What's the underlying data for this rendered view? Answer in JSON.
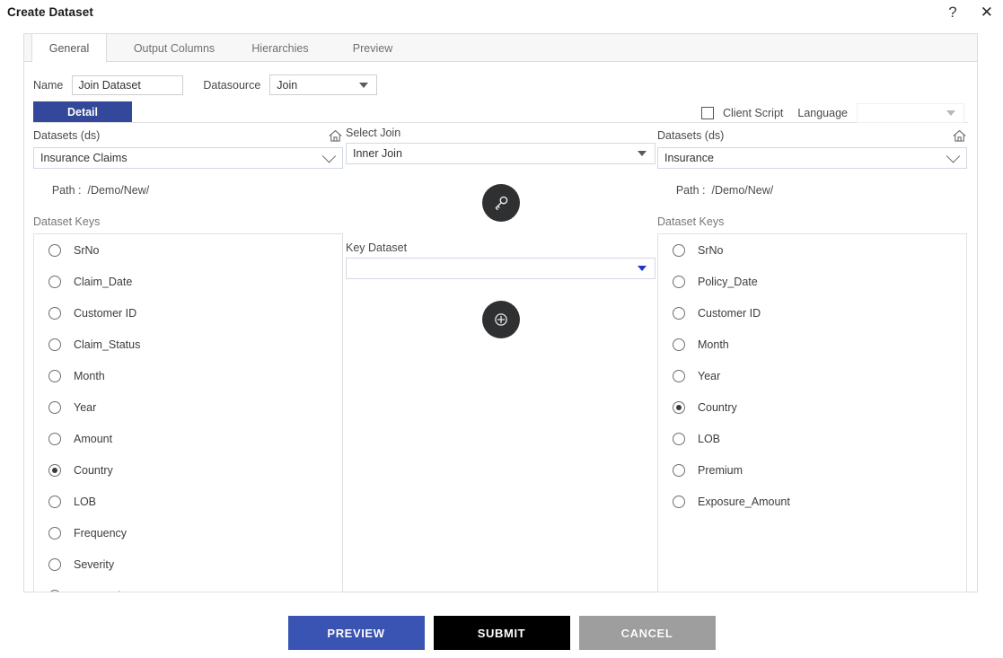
{
  "window": {
    "title": "Create Dataset",
    "help_icon": "question-mark-icon",
    "close_icon": "close-icon"
  },
  "tabs": [
    {
      "label": "General",
      "active": true
    },
    {
      "label": "Output Columns",
      "active": false
    },
    {
      "label": "Hierarchies",
      "active": false
    },
    {
      "label": "Preview",
      "active": false
    }
  ],
  "form": {
    "name_label": "Name",
    "name_value": "Join Dataset",
    "name_placeholder": "",
    "datasource_label": "Datasource",
    "datasource_value": "Join"
  },
  "detail_tab": {
    "label": "Detail",
    "color": "#33479b"
  },
  "options": {
    "client_script_label": "Client Script",
    "client_script_checked": false,
    "language_label": "Language",
    "language_value": "",
    "language_disabled": true
  },
  "left_panel": {
    "datasets_label": "Datasets (ds)",
    "home_icon": "home-icon",
    "dataset_value": "Insurance Claims",
    "path_label": "Path :",
    "path_value": "/Demo/New/",
    "keys_label": "Dataset Keys",
    "keys": [
      {
        "label": "SrNo",
        "selected": false
      },
      {
        "label": "Claim_Date",
        "selected": false
      },
      {
        "label": "Customer ID",
        "selected": false
      },
      {
        "label": "Claim_Status",
        "selected": false
      },
      {
        "label": "Month",
        "selected": false
      },
      {
        "label": "Year",
        "selected": false
      },
      {
        "label": "Amount",
        "selected": false
      },
      {
        "label": "Country",
        "selected": true
      },
      {
        "label": "LOB",
        "selected": false
      },
      {
        "label": "Frequency",
        "selected": false
      },
      {
        "label": "Severity",
        "selected": false
      },
      {
        "label": "Loss Ratio",
        "selected": false
      }
    ]
  },
  "middle_panel": {
    "select_join_label": "Select Join",
    "select_join_value": "Inner Join",
    "key_icon": "key-icon",
    "key_dataset_label": "Key Dataset",
    "key_dataset_value": "",
    "add_icon": "plus-circle-icon"
  },
  "right_panel": {
    "datasets_label": "Datasets (ds)",
    "home_icon": "home-icon",
    "dataset_value": "Insurance",
    "path_label": "Path :",
    "path_value": "/Demo/New/",
    "keys_label": "Dataset Keys",
    "keys": [
      {
        "label": "SrNo",
        "selected": false
      },
      {
        "label": "Policy_Date",
        "selected": false
      },
      {
        "label": "Customer ID",
        "selected": false
      },
      {
        "label": "Month",
        "selected": false
      },
      {
        "label": "Year",
        "selected": false
      },
      {
        "label": "Country",
        "selected": true
      },
      {
        "label": "LOB",
        "selected": false
      },
      {
        "label": "Premium",
        "selected": false
      },
      {
        "label": "Exposure_Amount",
        "selected": false
      }
    ]
  },
  "footer": {
    "preview_label": "PREVIEW",
    "submit_label": "SUBMIT",
    "cancel_label": "CANCEL",
    "preview_color": "#3a54b4",
    "submit_color": "#000000",
    "cancel_color": "#9e9e9e"
  }
}
